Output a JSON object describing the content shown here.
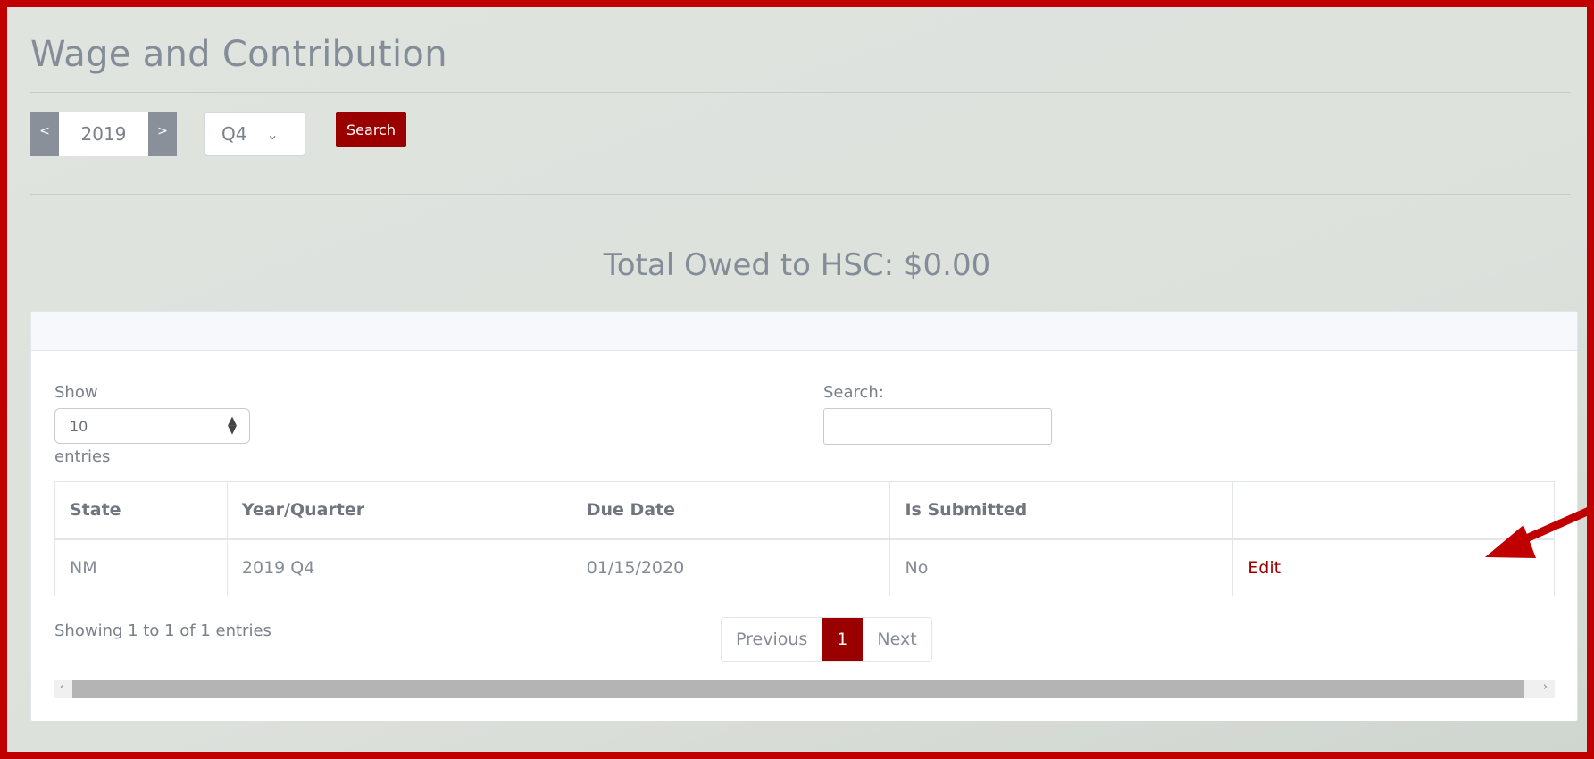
{
  "page": {
    "title": "Wage and Contribution",
    "total_owed": "Total Owed to HSC: $0.00"
  },
  "filters": {
    "prev_year_label": "<",
    "year": "2019",
    "next_year_label": ">",
    "quarter": "Q4",
    "search_label": "Search"
  },
  "table_controls": {
    "show_label": "Show",
    "page_length": "10",
    "entries_label": "entries",
    "search_label": "Search:",
    "search_value": ""
  },
  "table": {
    "headers": [
      "State",
      "Year/Quarter",
      "Due Date",
      "Is Submitted",
      ""
    ],
    "rows": [
      {
        "state": "NM",
        "year_quarter": "2019 Q4",
        "due_date": "01/15/2020",
        "is_submitted": "No",
        "action": "Edit"
      }
    ]
  },
  "pagination": {
    "info": "Showing 1 to 1 of 1 entries",
    "previous": "Previous",
    "current_page": "1",
    "next": "Next"
  },
  "colors": {
    "frame_border": "#c00000",
    "accent": "#9b0000",
    "annotation_arrow": "#c00000"
  },
  "icons": {
    "quarter_dropdown": "chevron-down-icon",
    "length_select": "sort-arrows-icon",
    "scroll_left": "chevron-left-icon",
    "scroll_right": "chevron-right-icon"
  }
}
